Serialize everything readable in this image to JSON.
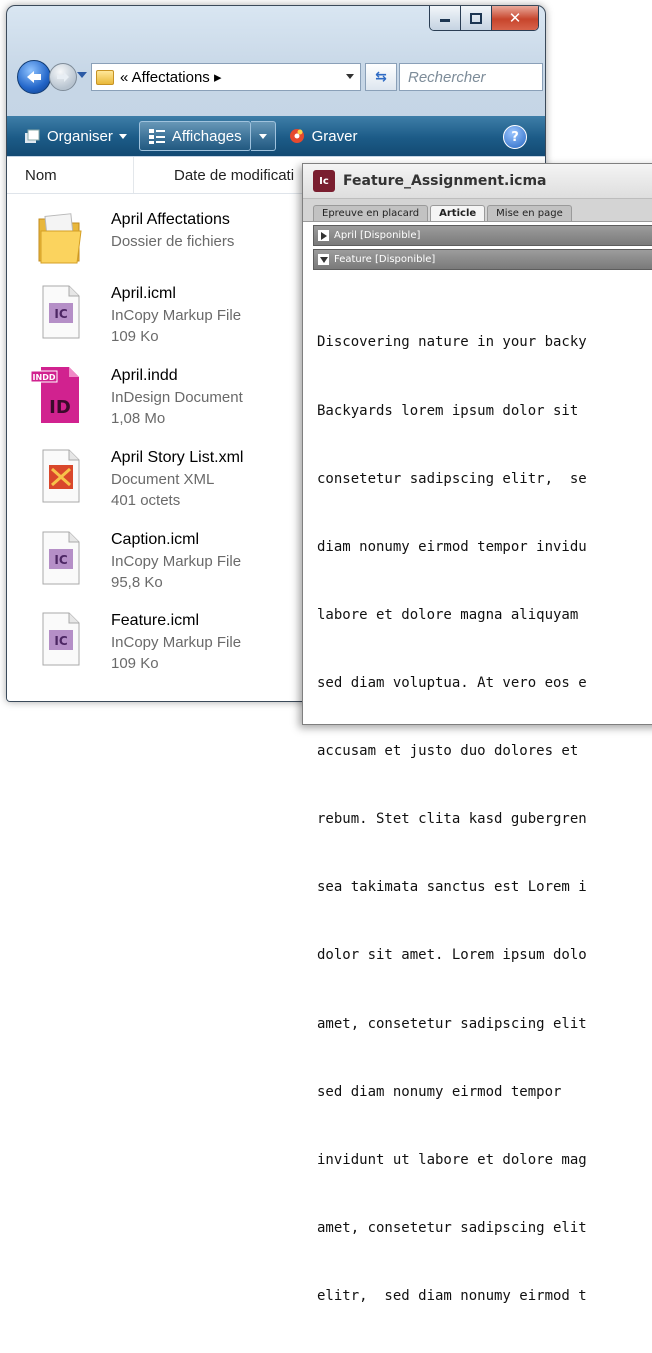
{
  "explorer": {
    "address": "« Affectations ▸",
    "search_placeholder": "Rechercher",
    "toolbar": {
      "organise_label": "Organiser",
      "views_label": "Affichages",
      "burn_label": "Graver",
      "help_label": "?"
    },
    "columns": {
      "name": "Nom",
      "date": "Date de modificati"
    },
    "files": [
      {
        "name": "April Affectations",
        "type": "Dossier de fichiers",
        "size": "",
        "icon": "folder-icon"
      },
      {
        "name": "April.icml",
        "type": "InCopy Markup File",
        "size": "109 Ko",
        "icon": "incopy-file-icon"
      },
      {
        "name": "April.indd",
        "type": "InDesign Document",
        "size": "1,08 Mo",
        "icon": "indesign-file-icon"
      },
      {
        "name": "April Story List.xml",
        "type": "Document XML",
        "size": "401 octets",
        "icon": "xml-file-icon"
      },
      {
        "name": "Caption.icml",
        "type": "InCopy Markup File",
        "size": "95,8 Ko",
        "icon": "incopy-file-icon"
      },
      {
        "name": "Feature.icml",
        "type": "InCopy Markup File",
        "size": "109 Ko",
        "icon": "incopy-file-icon"
      }
    ]
  },
  "incopy": {
    "badge": "Ic",
    "title": "Feature_Assignment.icma",
    "tabs": [
      "Epreuve en placard",
      "Article",
      "Mise en page"
    ],
    "stories": [
      "April [Disponible]",
      "Feature [Disponible]"
    ],
    "body_lines": [
      "Discovering nature in your backy",
      "Backyards lorem ipsum dolor sit",
      "consetetur sadipscing elitr,  se",
      "diam nonumy eirmod tempor invidu",
      "labore et dolore magna aliquyam",
      "sed diam voluptua. At vero eos e",
      "accusam et justo duo dolores et",
      "rebum. Stet clita kasd gubergren",
      "sea takimata sanctus est Lorem i",
      "dolor sit amet. Lorem ipsum dolo",
      "amet, consetetur sadipscing elit",
      "sed diam nonumy eirmod tempor",
      "invidunt ut labore et dolore mag",
      "amet, consetetur sadipscing elit",
      "elitr,  sed diam nonumy eirmod t"
    ]
  }
}
